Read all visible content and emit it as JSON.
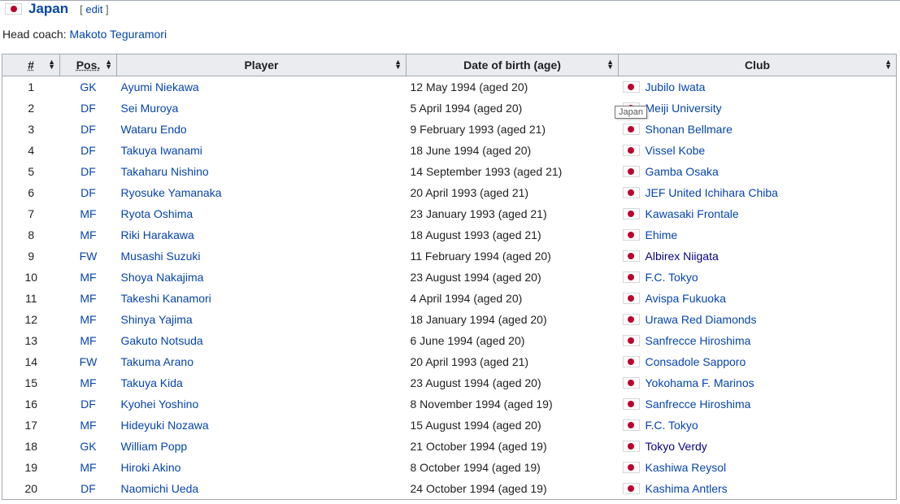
{
  "section": {
    "title": "Japan",
    "edit_open": "[",
    "edit_label": "edit",
    "edit_close": "]"
  },
  "coach": {
    "label": "Head coach:",
    "name": "Makoto Teguramori"
  },
  "table": {
    "headers": {
      "num": "#",
      "pos": "Pos.",
      "player": "Player",
      "dob": "Date of birth (age)",
      "club": "Club"
    },
    "rows": [
      {
        "num": "1",
        "pos": "GK",
        "player": "Ayumi Niekawa",
        "dob": "12 May 1994 (aged 20)",
        "club": "Jubilo Iwata",
        "visited": false
      },
      {
        "num": "2",
        "pos": "DF",
        "player": "Sei Muroya",
        "dob": "5 April 1994 (aged 20)",
        "club": "Meiji University",
        "visited": false
      },
      {
        "num": "3",
        "pos": "DF",
        "player": "Wataru Endo",
        "dob": "9 February 1993 (aged 21)",
        "club": "Shonan Bellmare",
        "visited": false
      },
      {
        "num": "4",
        "pos": "DF",
        "player": "Takuya Iwanami",
        "dob": "18 June 1994 (aged 20)",
        "club": "Vissel Kobe",
        "visited": false
      },
      {
        "num": "5",
        "pos": "DF",
        "player": "Takaharu Nishino",
        "dob": "14 September 1993 (aged 21)",
        "club": "Gamba Osaka",
        "visited": false
      },
      {
        "num": "6",
        "pos": "DF",
        "player": "Ryosuke Yamanaka",
        "dob": "20 April 1993 (aged 21)",
        "club": "JEF United Ichihara Chiba",
        "visited": false
      },
      {
        "num": "7",
        "pos": "MF",
        "player": "Ryota Oshima",
        "dob": "23 January 1993 (aged 21)",
        "club": "Kawasaki Frontale",
        "visited": false
      },
      {
        "num": "8",
        "pos": "MF",
        "player": "Riki Harakawa",
        "dob": "18 August 1993 (aged 21)",
        "club": "Ehime",
        "visited": false
      },
      {
        "num": "9",
        "pos": "FW",
        "player": "Musashi Suzuki",
        "dob": "11 February 1994 (aged 20)",
        "club": "Albirex Niigata",
        "visited": true
      },
      {
        "num": "10",
        "pos": "MF",
        "player": "Shoya Nakajima",
        "dob": "23 August 1994 (aged 20)",
        "club": "F.C. Tokyo",
        "visited": false
      },
      {
        "num": "11",
        "pos": "MF",
        "player": "Takeshi Kanamori",
        "dob": "4 April 1994 (aged 20)",
        "club": "Avispa Fukuoka",
        "visited": false
      },
      {
        "num": "12",
        "pos": "MF",
        "player": "Shinya Yajima",
        "dob": "18 January 1994 (aged 20)",
        "club": "Urawa Red Diamonds",
        "visited": false
      },
      {
        "num": "13",
        "pos": "MF",
        "player": "Gakuto Notsuda",
        "dob": "6 June 1994 (aged 20)",
        "club": "Sanfrecce Hiroshima",
        "visited": false
      },
      {
        "num": "14",
        "pos": "FW",
        "player": "Takuma Arano",
        "dob": "20 April 1993 (aged 21)",
        "club": "Consadole Sapporo",
        "visited": false
      },
      {
        "num": "15",
        "pos": "MF",
        "player": "Takuya Kida",
        "dob": "23 August 1994 (aged 20)",
        "club": "Yokohama F. Marinos",
        "visited": false
      },
      {
        "num": "16",
        "pos": "DF",
        "player": "Kyohei Yoshino",
        "dob": "8 November 1994 (aged 19)",
        "club": "Sanfrecce Hiroshima",
        "visited": false
      },
      {
        "num": "17",
        "pos": "MF",
        "player": "Hideyuki Nozawa",
        "dob": "15 August 1994 (aged 20)",
        "club": "F.C. Tokyo",
        "visited": false
      },
      {
        "num": "18",
        "pos": "GK",
        "player": "William Popp",
        "dob": "21 October 1994 (aged 19)",
        "club": "Tokyo Verdy",
        "visited": true
      },
      {
        "num": "19",
        "pos": "MF",
        "player": "Hiroki Akino",
        "dob": "8 October 1994 (aged 19)",
        "club": "Kashiwa Reysol",
        "visited": false
      },
      {
        "num": "20",
        "pos": "DF",
        "player": "Naomichi Ueda",
        "dob": "24 October 1994 (aged 19)",
        "club": "Kashima Antlers",
        "visited": false
      }
    ]
  },
  "tooltip": {
    "text": "Japan"
  },
  "colors": {
    "link": "#0645ad",
    "visited_link": "#0b0080",
    "flag_red": "#bc002d",
    "header_bg": "#eaecf0"
  }
}
